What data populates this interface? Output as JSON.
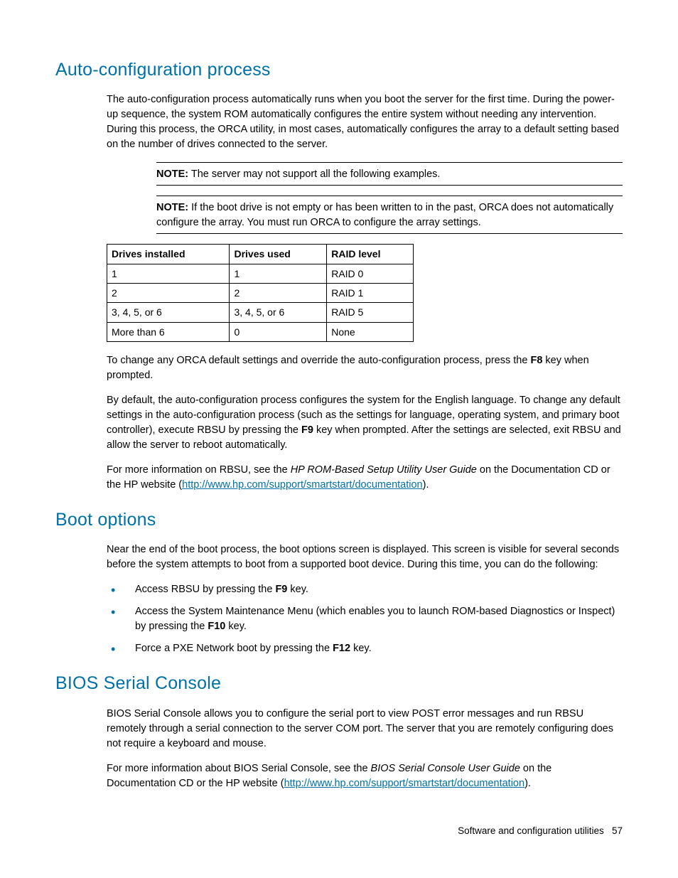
{
  "sections": {
    "autoconfig": {
      "heading": "Auto-configuration process",
      "intro": "The auto-configuration process automatically runs when you boot the server for the first time. During the power-up sequence, the system ROM automatically configures the entire system without needing any intervention. During this process, the ORCA utility, in most cases, automatically configures the array to a default setting based on the number of drives connected to the server.",
      "note1_label": "NOTE:",
      "note1_text": "  The server may not support all the following examples.",
      "note2_label": "NOTE:",
      "note2_text": "  If the boot drive is not empty or has been written to in the past, ORCA does not automatically configure the array. You must run ORCA to configure the array settings.",
      "table": {
        "headers": [
          "Drives installed",
          "Drives used",
          "RAID level"
        ],
        "rows": [
          [
            "1",
            "1",
            "RAID 0"
          ],
          [
            "2",
            "2",
            "RAID 1"
          ],
          [
            "3, 4, 5, or 6",
            "3, 4, 5, or 6",
            "RAID 5"
          ],
          [
            "More than 6",
            "0",
            "None"
          ]
        ]
      },
      "p2_pre": "To change any ORCA default settings and override the auto-configuration process, press the ",
      "p2_key": "F8",
      "p2_post": " key when prompted.",
      "p3_pre": "By default, the auto-configuration process configures the system for the English language. To change any default settings in the auto-configuration process (such as the settings for language, operating system, and primary boot controller), execute RBSU by pressing the ",
      "p3_key": "F9",
      "p3_post": " key when prompted. After the settings are selected, exit RBSU and allow the server to reboot automatically.",
      "p4_pre": "For more information on RBSU, see the ",
      "p4_doc": "HP ROM-Based Setup Utility User Guide",
      "p4_mid": " on the Documentation CD or the HP website (",
      "p4_link": "http://www.hp.com/support/smartstart/documentation",
      "p4_post": ")."
    },
    "boot": {
      "heading": "Boot options",
      "intro": "Near the end of the boot process, the boot options screen is displayed. This screen is visible for several seconds before the system attempts to boot from a supported boot device. During this time, you can do the following:",
      "items": [
        {
          "pre": "Access RBSU by pressing the ",
          "key": "F9",
          "post": " key."
        },
        {
          "pre": "Access the System Maintenance Menu (which enables you to launch ROM-based Diagnostics or Inspect) by pressing the ",
          "key": "F10",
          "post": " key."
        },
        {
          "pre": "Force a PXE Network boot by pressing the ",
          "key": "F12",
          "post": " key."
        }
      ]
    },
    "bios": {
      "heading": "BIOS Serial Console",
      "p1": "BIOS Serial Console allows you to configure the serial port to view POST error messages and run RBSU remotely through a serial connection to the server COM port. The server that you are remotely configuring does not require a keyboard and mouse.",
      "p2_pre": "For more information about BIOS Serial Console, see the ",
      "p2_doc": "BIOS Serial Console User Guide",
      "p2_mid": " on the Documentation CD or the HP website (",
      "p2_link": "http://www.hp.com/support/smartstart/documentation",
      "p2_post": ")."
    }
  },
  "footer": {
    "text": "Software and configuration utilities",
    "page": "57"
  }
}
